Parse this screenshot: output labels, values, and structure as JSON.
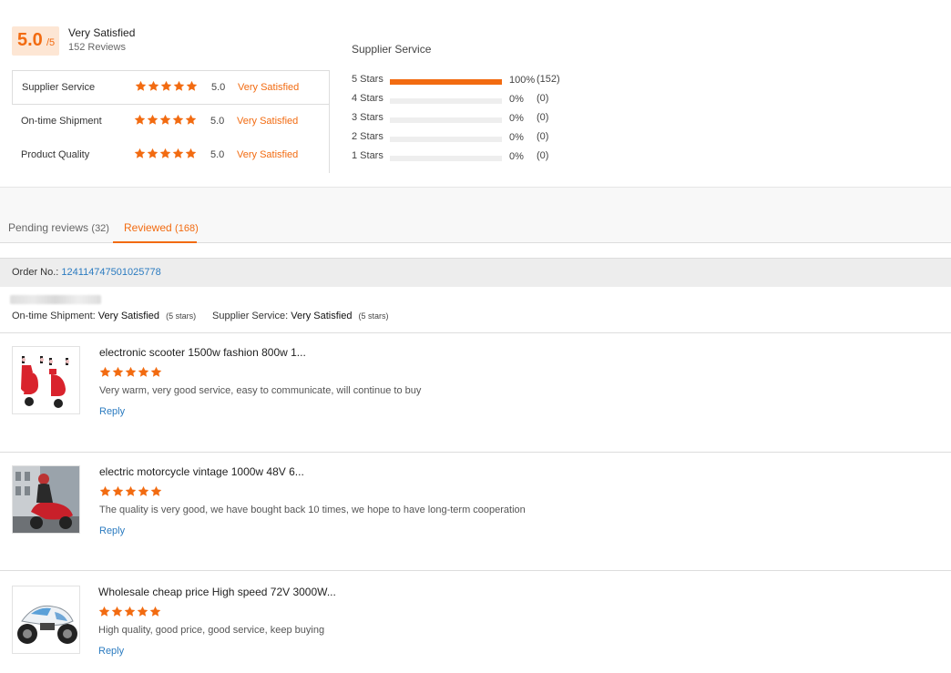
{
  "colors": {
    "accent": "#f26b11",
    "link": "#2b7bc0",
    "badge_bg": "#fde6d4"
  },
  "overall": {
    "score": "5.0",
    "out_of": "/5",
    "label": "Very Satisfied",
    "reviews": "152 Reviews",
    "rating_stars": 5
  },
  "dimensions": [
    {
      "label": "Supplier Service",
      "stars": 5,
      "score": "5.0",
      "text": "Very Satisfied"
    },
    {
      "label": "On-time Shipment",
      "stars": 5,
      "score": "5.0",
      "text": "Very Satisfied"
    },
    {
      "label": "Product Quality",
      "stars": 5,
      "score": "5.0",
      "text": "Very Satisfied"
    }
  ],
  "distribution": {
    "title": "Supplier Service",
    "rows": [
      {
        "label": "5 Stars",
        "fraction": 1.0,
        "pct": "100%",
        "count": "(152)"
      },
      {
        "label": "4 Stars",
        "fraction": 0,
        "pct": "0%",
        "count": "(0)"
      },
      {
        "label": "3 Stars",
        "fraction": 0,
        "pct": "0%",
        "count": "(0)"
      },
      {
        "label": "2 Stars",
        "fraction": 0,
        "pct": "0%",
        "count": "(0)"
      },
      {
        "label": "1 Stars",
        "fraction": 0,
        "pct": "0%",
        "count": "(0)"
      }
    ]
  },
  "tabs": {
    "pending": {
      "label": "Pending reviews",
      "count": "(32)"
    },
    "reviewed": {
      "label": "Reviewed",
      "count": "(168)",
      "active": true
    }
  },
  "order": {
    "label": "Order No.:",
    "number": "124114747501025778",
    "shipment_label": "On-time Shipment:",
    "shipment_value": "Very Satisfied",
    "shipment_stars": "(5 stars)",
    "service_label": "Supplier Service:",
    "service_value": "Very Satisfied",
    "service_stars": "(5 stars)"
  },
  "reviews": [
    {
      "title": "electronic scooter 1500w fashion 800w 1...",
      "stars": 5,
      "text": "Very warm, very good service, easy to communicate, will continue to buy",
      "reply": "Reply",
      "thumb": "red-scooter-pair-thumbnail"
    },
    {
      "title": "electric motorcycle vintage 1000w 48V 6...",
      "stars": 5,
      "text": "The quality is very good, we have bought back 10 times, we hope to have long-term cooperation",
      "reply": "Reply",
      "thumb": "rider-on-red-scooter-thumbnail"
    },
    {
      "title": "Wholesale cheap price High speed 72V 3000W...",
      "stars": 5,
      "text": "High quality, good price, good service, keep buying",
      "reply": "Reply",
      "thumb": "white-sport-motorcycle-thumbnail"
    }
  ]
}
